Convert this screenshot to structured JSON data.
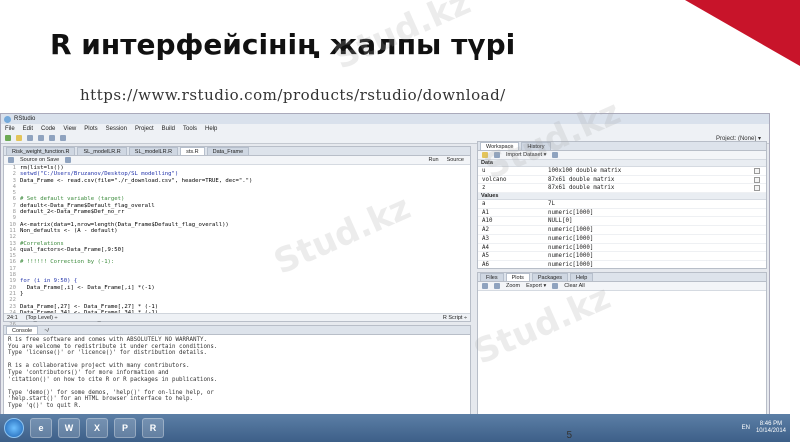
{
  "slide": {
    "title": "R интерфейсінің жалпы түрі",
    "url": "https://www.rstudio.com/products/rstudio/download/",
    "page_number": "5",
    "watermark": "Stud.kz",
    "accent_color": "#c8142a"
  },
  "window": {
    "title": "RStudio",
    "menu": [
      "File",
      "Edit",
      "Code",
      "View",
      "Plots",
      "Session",
      "Project",
      "Build",
      "Tools",
      "Help"
    ],
    "project": "Project: (None) ▾"
  },
  "editor": {
    "tabs": [
      "Risk_weight_function.R",
      "SL_modelLR.R",
      "SL_modelLR.R",
      "sts.R",
      "Data_Frame"
    ],
    "source_on_save": "Source on Save",
    "run": "Run",
    "source": "Source",
    "lines": [
      {
        "n": "1",
        "t": "rm(list=ls())",
        "k": ""
      },
      {
        "n": "2",
        "t": "setwd(\"C:/Users/Bruzanov/Desktop/SL modelling\")",
        "k": "s"
      },
      {
        "n": "3",
        "t": "Data_Frame <- read.csv(file=\"./r_download.csv\", header=TRUE, dec=\".\")",
        "k": ""
      },
      {
        "n": "4",
        "t": "",
        "k": ""
      },
      {
        "n": "5",
        "t": "",
        "k": ""
      },
      {
        "n": "6",
        "t": "# Set default variable (target)",
        "k": "c"
      },
      {
        "n": "7",
        "t": "default<-Data_Frame$Default_flag_overall",
        "k": ""
      },
      {
        "n": "8",
        "t": "default_2<-Data_Frame$Def_no_rr",
        "k": ""
      },
      {
        "n": "9",
        "t": "",
        "k": ""
      },
      {
        "n": "10",
        "t": "A<-matrix(data=1,nrow=length(Data_Frame$Default_flag_overall))",
        "k": ""
      },
      {
        "n": "11",
        "t": "Non_defaults <- (A - default)",
        "k": ""
      },
      {
        "n": "12",
        "t": "",
        "k": ""
      },
      {
        "n": "13",
        "t": "#Correlations",
        "k": "c"
      },
      {
        "n": "14",
        "t": "qual_factors<-Data_Frame[,9:50]",
        "k": ""
      },
      {
        "n": "15",
        "t": "",
        "k": ""
      },
      {
        "n": "16",
        "t": "# !!!!!! Correction by (-1):",
        "k": "c"
      },
      {
        "n": "17",
        "t": "",
        "k": ""
      },
      {
        "n": "18",
        "t": "",
        "k": ""
      },
      {
        "n": "19",
        "t": "for (i in 9:50) {",
        "k": "s"
      },
      {
        "n": "20",
        "t": "  Data_Frame[,i] <- Data_Frame[,i] *(-1)",
        "k": ""
      },
      {
        "n": "21",
        "t": "}",
        "k": ""
      },
      {
        "n": "22",
        "t": "",
        "k": ""
      },
      {
        "n": "23",
        "t": "Data_Frame[,27] <- Data_Frame[,27] * (-1)",
        "k": ""
      },
      {
        "n": "24",
        "t": "Data_Frame[,34] <- Data_Frame[,34] * (-1)",
        "k": ""
      },
      {
        "n": "25",
        "t": "Data_Frame[,45] <- Data_Frame[,45] * (-1)",
        "k": ""
      },
      {
        "n": "26",
        "t": "",
        "k": ""
      },
      {
        "n": "27",
        "t": "Data_Frame$F4 <- Data_Frame$F4 * (-1)",
        "k": ""
      }
    ],
    "status_left": "24:1",
    "status_mid": "(Top Level) ÷",
    "status_right": "R Script ÷"
  },
  "console": {
    "tab": "Console",
    "path": "~/",
    "text": "R is free software and comes with ABSOLUTELY NO WARRANTY.\nYou are welcome to redistribute it under certain conditions.\nType 'license()' or 'licence()' for distribution details.\n\nR is a collaborative project with many contributors.\nType 'contributors()' for more information and\n'citation()' on how to cite R or R packages in publications.\n\nType 'demo()' for some demos, 'help()' for on-line help, or\n'help.start()' for an HTML browser interface to help.\nType 'q()' to quit R.\n\n[Workspace loaded from ~/.RData]\n\n>"
  },
  "workspace": {
    "tabs": [
      "Workspace",
      "History"
    ],
    "import": "Import Dataset ▾",
    "clear": "Clear All",
    "data_header": "Data",
    "data": [
      {
        "name": "u",
        "value": "100x100 double matrix"
      },
      {
        "name": "volcano",
        "value": "87x61 double matrix"
      },
      {
        "name": "z",
        "value": "87x61 double matrix"
      }
    ],
    "values_header": "Values",
    "values": [
      {
        "name": "a",
        "value": "7L"
      },
      {
        "name": "A1",
        "value": "numeric[1000]"
      },
      {
        "name": "A10",
        "value": "NULL[0]"
      },
      {
        "name": "A2",
        "value": "numeric[1000]"
      },
      {
        "name": "A3",
        "value": "numeric[1000]"
      },
      {
        "name": "A4",
        "value": "numeric[1000]"
      },
      {
        "name": "A5",
        "value": "numeric[1000]"
      },
      {
        "name": "A6",
        "value": "numeric[1000]"
      },
      {
        "name": "A7",
        "value": "numeric[1000]"
      }
    ]
  },
  "files": {
    "tabs": [
      "Files",
      "Plots",
      "Packages",
      "Help"
    ],
    "zoom": "Zoom",
    "export": "Export ▾",
    "clear": "Clear All"
  },
  "taskbar": {
    "apps": [
      "e",
      "W",
      "X",
      "P",
      "R"
    ],
    "lang": "EN",
    "time": "8:46 PM",
    "date": "10/14/2014"
  }
}
